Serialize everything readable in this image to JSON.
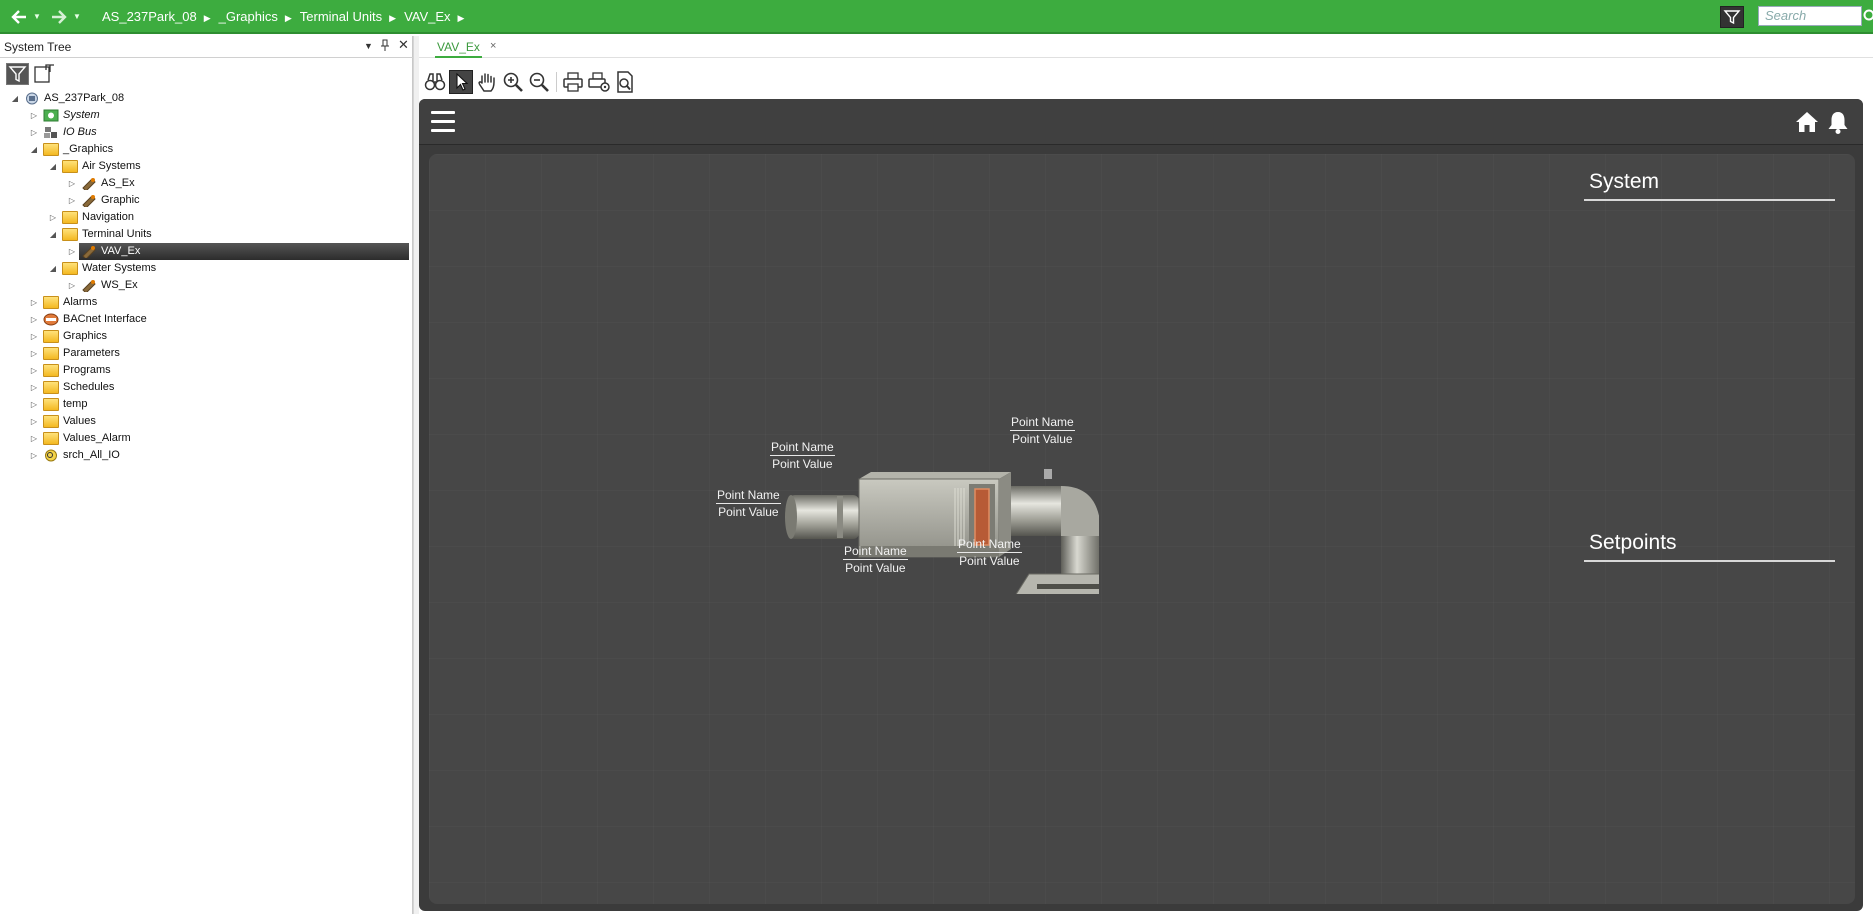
{
  "topbar": {
    "breadcrumb": [
      "AS_237Park_08",
      "_Graphics",
      "Terminal Units",
      "VAV_Ex"
    ],
    "search_placeholder": "Search",
    "accent": "#3dac3f"
  },
  "left_panel": {
    "title": "System Tree",
    "tree": [
      {
        "label": "AS_237Park_08",
        "icon": "server-icon",
        "level": 0,
        "expanded": true
      },
      {
        "label": "System",
        "icon": "system-icon",
        "level": 1,
        "expanded": false
      },
      {
        "label": "IO Bus",
        "icon": "io-bus-icon",
        "level": 1,
        "expanded": false
      },
      {
        "label": "_Graphics",
        "icon": "folder-icon",
        "level": 1,
        "expanded": true
      },
      {
        "label": "Air Systems",
        "icon": "folder-icon",
        "level": 2,
        "expanded": true
      },
      {
        "label": "AS_Ex",
        "icon": "graphic-icon",
        "level": 3,
        "expanded": false
      },
      {
        "label": "Graphic",
        "icon": "graphic-icon",
        "level": 3,
        "expanded": false
      },
      {
        "label": "Navigation",
        "icon": "folder-icon",
        "level": 2,
        "expanded": false
      },
      {
        "label": "Terminal Units",
        "icon": "folder-icon",
        "level": 2,
        "expanded": true
      },
      {
        "label": "VAV_Ex",
        "icon": "graphic-icon",
        "level": 3,
        "expanded": false,
        "selected": true
      },
      {
        "label": "Water Systems",
        "icon": "folder-icon",
        "level": 2,
        "expanded": true
      },
      {
        "label": "WS_Ex",
        "icon": "graphic-icon",
        "level": 3,
        "expanded": false
      },
      {
        "label": "Alarms",
        "icon": "folder-icon",
        "level": 1,
        "expanded": false
      },
      {
        "label": "BACnet Interface",
        "icon": "bacnet-icon",
        "level": 1,
        "expanded": false
      },
      {
        "label": "Graphics",
        "icon": "folder-icon",
        "level": 1,
        "expanded": false
      },
      {
        "label": "Parameters",
        "icon": "folder-icon",
        "level": 1,
        "expanded": false
      },
      {
        "label": "Programs",
        "icon": "folder-icon",
        "level": 1,
        "expanded": false
      },
      {
        "label": "Schedules",
        "icon": "folder-icon",
        "level": 1,
        "expanded": false
      },
      {
        "label": "temp",
        "icon": "folder-icon",
        "level": 1,
        "expanded": false
      },
      {
        "label": "Values",
        "icon": "folder-icon",
        "level": 1,
        "expanded": false
      },
      {
        "label": "Values_Alarm",
        "icon": "folder-icon",
        "level": 1,
        "expanded": false
      },
      {
        "label": "srch_All_IO",
        "icon": "search-object-icon",
        "level": 1,
        "expanded": false
      }
    ]
  },
  "tab": {
    "label": "VAV_Ex",
    "close": "×"
  },
  "graphic": {
    "sections": {
      "system": "System",
      "setpoints": "Setpoints"
    },
    "points": [
      {
        "name": "Point Name",
        "value": "Point Value"
      },
      {
        "name": "Point Name",
        "value": "Point Value"
      },
      {
        "name": "Point Name",
        "value": "Point Value"
      },
      {
        "name": "Point Name",
        "value": "Point Value"
      },
      {
        "name": "Point Name",
        "value": "Point Value"
      }
    ]
  }
}
